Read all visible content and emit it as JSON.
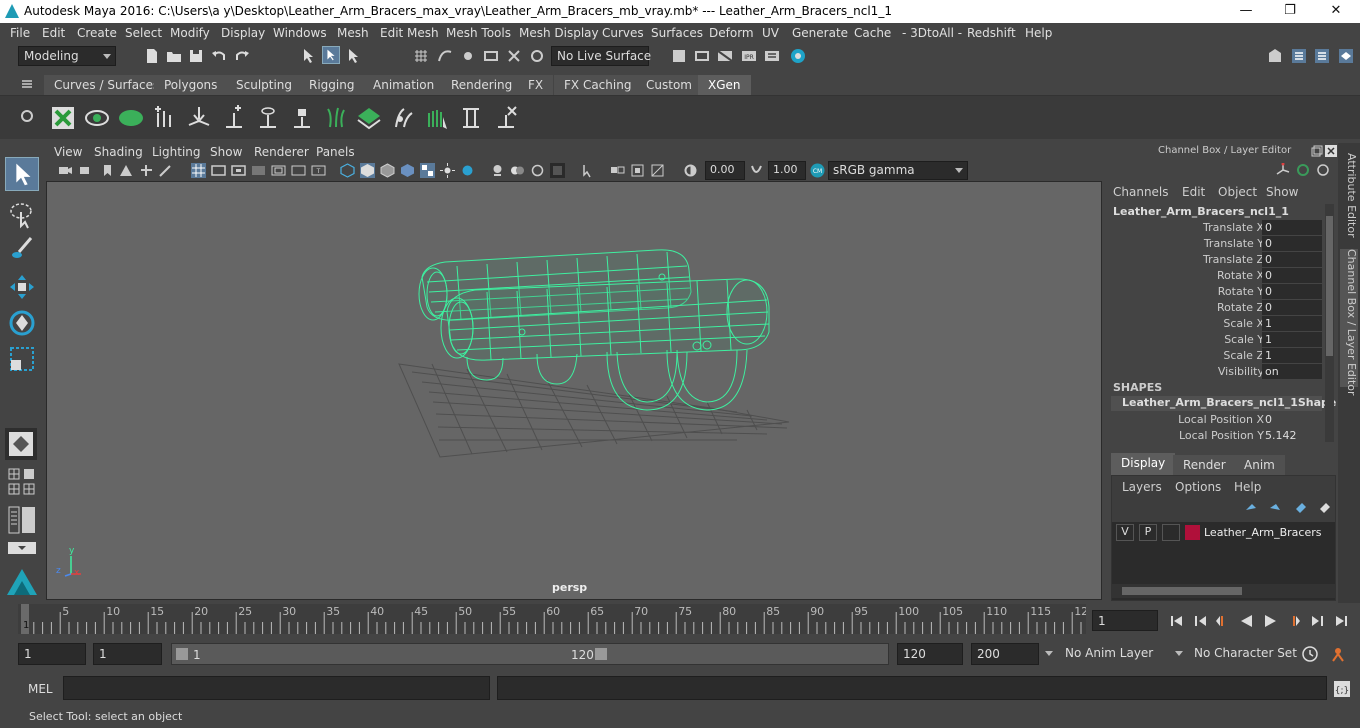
{
  "title_bar": {
    "text": "Autodesk Maya 2016: C:\\Users\\a y\\Desktop\\Leather_Arm_Bracers_max_vray\\Leather_Arm_Bracers_mb_vray.mb*   ---   Leather_Arm_Bracers_ncl1_1"
  },
  "menu": [
    "File",
    "Edit",
    "Create",
    "Select",
    "Modify",
    "Display",
    "Windows",
    "Mesh",
    "Edit Mesh",
    "Mesh Tools",
    "Mesh Display",
    "Curves",
    "Surfaces",
    "Deform",
    "UV",
    "Generate",
    "Cache",
    "- 3DtoAll -",
    "Redshift",
    "Help"
  ],
  "status_line": {
    "mode": "Modeling",
    "live_surface": "No Live Surface"
  },
  "shelf_tabs": [
    "Curves / Surfaces",
    "Polygons",
    "Sculpting",
    "Rigging",
    "Animation",
    "Rendering",
    "FX",
    "FX Caching",
    "Custom",
    "XGen"
  ],
  "active_shelf": "XGen",
  "panel_menu": [
    "View",
    "Shading",
    "Lighting",
    "Show",
    "Renderer",
    "Panels"
  ],
  "panel_tools": {
    "exposure": "0.00",
    "gamma": "1.00",
    "color_space": "sRGB gamma"
  },
  "viewport": {
    "camera": "persp",
    "axis_y": "y",
    "axis_z": "z",
    "axis_x": "x"
  },
  "channel_box": {
    "header": "Channel Box / Layer Editor",
    "menu": [
      "Channels",
      "Edit",
      "Object",
      "Show"
    ],
    "object": "Leather_Arm_Bracers_ncl1_1",
    "channels": [
      {
        "name": "Translate X",
        "value": "0"
      },
      {
        "name": "Translate Y",
        "value": "0"
      },
      {
        "name": "Translate Z",
        "value": "0"
      },
      {
        "name": "Rotate X",
        "value": "0"
      },
      {
        "name": "Rotate Y",
        "value": "0"
      },
      {
        "name": "Rotate Z",
        "value": "0"
      },
      {
        "name": "Scale X",
        "value": "1"
      },
      {
        "name": "Scale Y",
        "value": "1"
      },
      {
        "name": "Scale Z",
        "value": "1"
      },
      {
        "name": "Visibility",
        "value": "on"
      }
    ],
    "shapes_label": "SHAPES",
    "shape_name": "Leather_Arm_Bracers_ncl1_1Shape",
    "shape_channels": [
      {
        "name": "Local Position X",
        "value": "0"
      },
      {
        "name": "Local Position Y",
        "value": "5.142"
      }
    ]
  },
  "layer_editor": {
    "tabs": [
      "Display",
      "Render",
      "Anim"
    ],
    "active_tab": "Display",
    "menu": [
      "Layers",
      "Options",
      "Help"
    ],
    "layer": {
      "v": "V",
      "p": "P",
      "name": "Leather_Arm_Bracers",
      "color": "#b0103a"
    }
  },
  "side_tabs": [
    "Attribute Editor",
    "Channel Box / Layer Editor"
  ],
  "time_slider": {
    "ticks": [
      "5",
      "10",
      "15",
      "20",
      "25",
      "30",
      "35",
      "40",
      "45",
      "50",
      "55",
      "60",
      "65",
      "70",
      "75",
      "80",
      "85",
      "90",
      "95",
      "100",
      "105",
      "110",
      "115",
      "12"
    ],
    "current_frame": "1",
    "frame_field": "1"
  },
  "range": {
    "start": "1",
    "anim_start": "1",
    "range_start": "1",
    "range_end": "120",
    "anim_end_field": "120",
    "total_end": "200",
    "anim_layer": "No Anim Layer",
    "character_set": "No Character Set"
  },
  "mel": {
    "label": "MEL"
  },
  "help_line": "Select Tool: select an object",
  "colors": {
    "wire": "#3ef0a0",
    "viewport_bg": "#666666",
    "grid": "#4a4a4a"
  }
}
